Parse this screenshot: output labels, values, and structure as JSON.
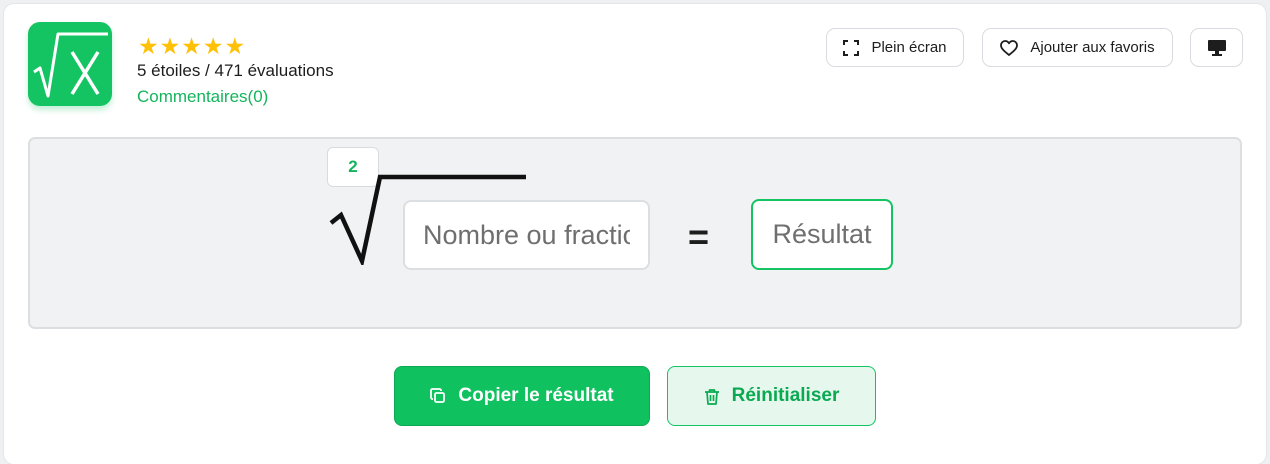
{
  "header": {
    "app_icon": "square-root-x-icon",
    "stars": "★★★★★",
    "rating_value": 5,
    "rating_text": "5 étoiles / 471 évaluations",
    "comments_link": "Commentaires(0)"
  },
  "toolbar": {
    "fullscreen_label": "Plein écran",
    "fullscreen_icon": "fullscreen-icon",
    "favorites_label": "Ajouter aux favoris",
    "favorites_icon": "heart-icon",
    "desktop_icon": "monitor-icon"
  },
  "calculator": {
    "root_index": "2",
    "input_placeholder": "Nombre ou fraction",
    "input_value": "",
    "equals_sign": "=",
    "result_placeholder": "Résultat"
  },
  "actions": {
    "copy_label": "Copier le résultat",
    "copy_icon": "copy-icon",
    "reset_label": "Réinitialiser",
    "reset_icon": "trash-icon"
  },
  "colors": {
    "accent": "#14c463",
    "accent_dark": "#0aa952",
    "star": "#ffc107",
    "panel_bg": "#f1f2f3",
    "reset_bg": "#e6f8ee"
  }
}
